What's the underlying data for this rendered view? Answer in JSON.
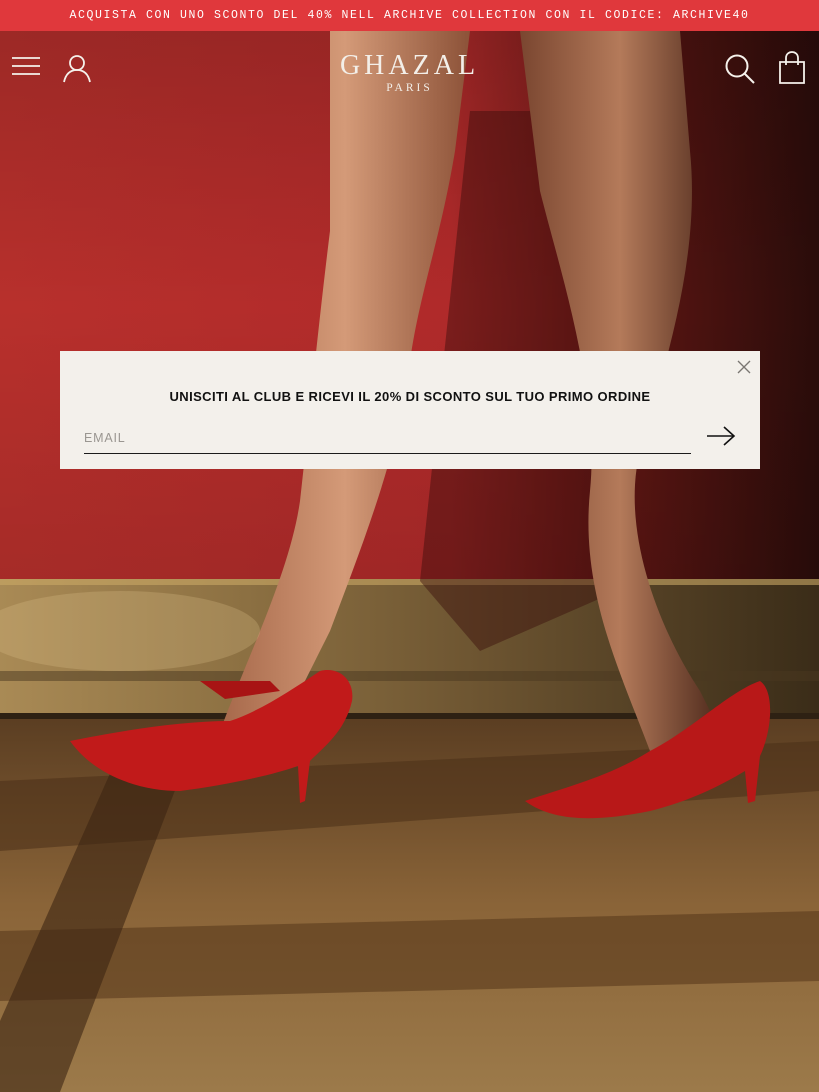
{
  "promo": {
    "text": "ACQUISTA CON UNO SCONTO DEL 40% NELL ARCHIVE COLLECTION CON IL CODICE: ARCHIVE40",
    "bg_color": "#e0383c"
  },
  "header": {
    "brand": "GHAZAL",
    "sub_brand": "PARIS",
    "icons": [
      "menu-icon",
      "account-icon",
      "search-icon",
      "shopping-bag-icon"
    ]
  },
  "newsletter": {
    "title": "UNISCITI AL CLUB E RICEVI IL 20% DI SCONTO SUL TUO PRIMO ORDINE",
    "email_placeholder": "EMAIL",
    "email_value": "",
    "submit_icon": "arrow-right-icon",
    "close_icon": "close-icon"
  },
  "colors": {
    "wall": "#b3282a",
    "shoe": "#c11a1a",
    "modal_bg": "#f3f0eb"
  }
}
